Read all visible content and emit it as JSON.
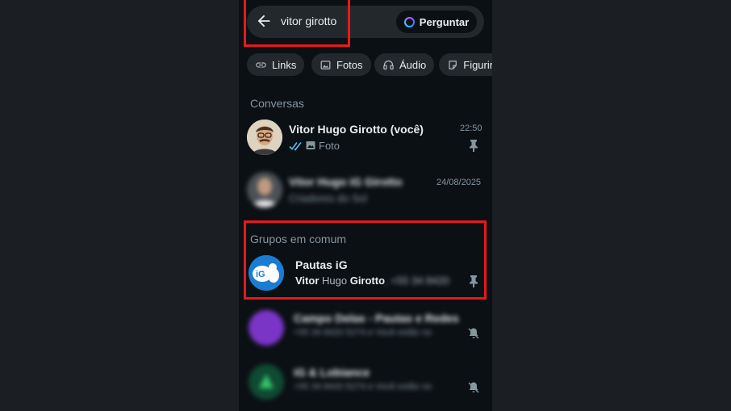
{
  "search": {
    "query": "vitor girotto",
    "ask_label": "Perguntar"
  },
  "chips": [
    {
      "label": "Links",
      "icon": "link-icon"
    },
    {
      "label": "Fotos",
      "icon": "image-icon"
    },
    {
      "label": "Áudio",
      "icon": "headphones-icon"
    },
    {
      "label": "Figurin",
      "icon": "sticker-icon"
    }
  ],
  "conversas": {
    "heading": "Conversas",
    "items": [
      {
        "name": "Vitor Hugo Girotto (você)",
        "time": "22:50",
        "preview": "Foto",
        "ticks": "double-check-icon",
        "pinned": true
      },
      {
        "name": "Vitor Hugo iG Girotto",
        "time": "24/08/2025",
        "preview": "Criadores do Sol",
        "pinned": false
      }
    ]
  },
  "grupos": {
    "heading": "Grupos em comum",
    "items": [
      {
        "name": "Pautas iG",
        "preview_bold1": "Vitor",
        "preview_mid": " Hugo ",
        "preview_bold2": "Girotto",
        "preview_rest": ", +55 34 8420",
        "pinned": true
      },
      {
        "name": "Campo Delas - Pautas e Redes",
        "preview": "+55 34 8420 5274 e Você estão no",
        "muted": true
      },
      {
        "name": "iG & Lobiance",
        "preview": "+55 34 8420 5274 e Você estão no",
        "muted": true
      }
    ]
  },
  "colors": {
    "background": "#0b1014",
    "chip": "#23282c",
    "highlight_box": "#e8191b",
    "read_ticks": "#53bdeb",
    "ig_blue": "#1b7cd4"
  }
}
